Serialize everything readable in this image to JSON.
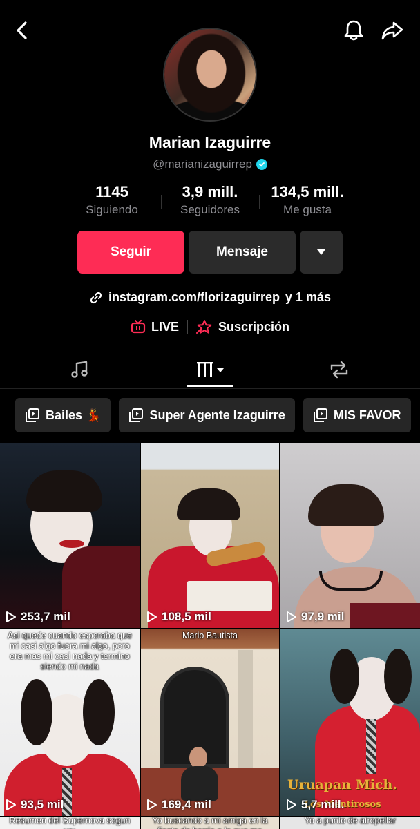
{
  "profile": {
    "name": "Marian Izaguirre",
    "handle": "@marianizaguirrep",
    "stats": [
      {
        "value": "1145",
        "label": "Siguiendo"
      },
      {
        "value": "3,9 mill.",
        "label": "Seguidores"
      },
      {
        "value": "134,5 mill.",
        "label": "Me gusta"
      }
    ],
    "follow_label": "Seguir",
    "message_label": "Mensaje",
    "link": "instagram.com/florizaguirrep",
    "link_more": "y 1 más",
    "live_label": "LIVE",
    "subscription_label": "Suscripción"
  },
  "playlists": [
    {
      "label": "Bailes 💃"
    },
    {
      "label": "Super Agente Izaguirre"
    },
    {
      "label": "MIS FAVOR"
    }
  ],
  "videos": [
    {
      "views": "253,7 mil",
      "caption": ""
    },
    {
      "views": "108,5 mil",
      "caption": ""
    },
    {
      "views": "97,9 mil",
      "caption": ""
    },
    {
      "views": "93,5 mil",
      "caption": "Asi quede cuando esperaba que mi casi algo fuera mi algo, pero era mas mi casi nada y termino siendo mi nada"
    },
    {
      "views": "169,4 mil",
      "caption": "Mario Bautista"
    },
    {
      "views": "5,7 mill.",
      "caption": "",
      "overlay": "Uruapan Mich.",
      "overlay2": "Los Mentirosos"
    }
  ],
  "bottom_captions": [
    "Resumen del Supernova segun yo:",
    "Yo buscando a mi amiga en la fiesta de barrio a la que me",
    "Yo a punto de atropellar"
  ],
  "colors": {
    "accent": "#fe2c55",
    "verified": "#20d5ec",
    "button_dark": "#2b2b2b"
  }
}
